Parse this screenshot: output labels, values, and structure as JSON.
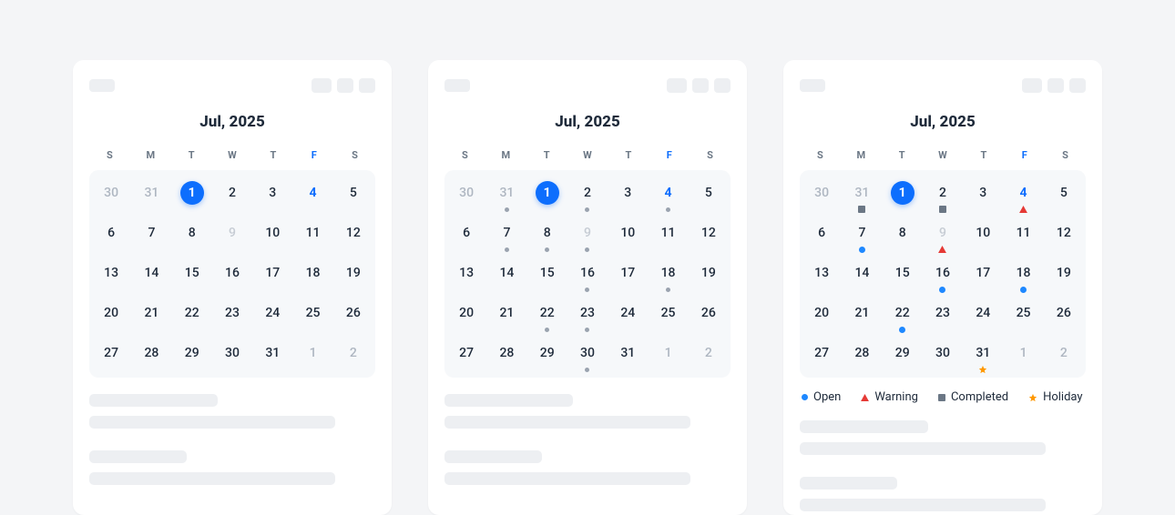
{
  "month_label": "Jul, 2025",
  "dow": [
    "S",
    "M",
    "T",
    "W",
    "T",
    "F",
    "S"
  ],
  "legend": {
    "open": "Open",
    "warning": "Warning",
    "completed": "Completed",
    "holiday": "Holiday"
  },
  "calendars": [
    {
      "id": "plain",
      "weeks": [
        [
          {
            "n": 30,
            "out": true
          },
          {
            "n": 31,
            "out": true
          },
          {
            "n": 1,
            "sel": true
          },
          {
            "n": 2
          },
          {
            "n": 3
          },
          {
            "n": 4,
            "fri": true
          },
          {
            "n": 5
          }
        ],
        [
          {
            "n": 6
          },
          {
            "n": 7
          },
          {
            "n": 8
          },
          {
            "n": 9,
            "dis": true
          },
          {
            "n": 10
          },
          {
            "n": 11
          },
          {
            "n": 12
          }
        ],
        [
          {
            "n": 13
          },
          {
            "n": 14
          },
          {
            "n": 15
          },
          {
            "n": 16
          },
          {
            "n": 17
          },
          {
            "n": 18
          },
          {
            "n": 19
          }
        ],
        [
          {
            "n": 20
          },
          {
            "n": 21
          },
          {
            "n": 22
          },
          {
            "n": 23
          },
          {
            "n": 24
          },
          {
            "n": 25
          },
          {
            "n": 26
          }
        ],
        [
          {
            "n": 27
          },
          {
            "n": 28
          },
          {
            "n": 29
          },
          {
            "n": 30
          },
          {
            "n": 31
          },
          {
            "n": 1,
            "out": true
          },
          {
            "n": 2,
            "out": true
          }
        ]
      ]
    },
    {
      "id": "dots",
      "weeks": [
        [
          {
            "n": 30,
            "out": true
          },
          {
            "n": 31,
            "out": true,
            "marks": [
              "dot"
            ]
          },
          {
            "n": 1,
            "sel": true
          },
          {
            "n": 2,
            "marks": [
              "dot"
            ]
          },
          {
            "n": 3
          },
          {
            "n": 4,
            "fri": true,
            "marks": [
              "dot"
            ]
          },
          {
            "n": 5
          }
        ],
        [
          {
            "n": 6
          },
          {
            "n": 7,
            "marks": [
              "dot"
            ]
          },
          {
            "n": 8,
            "marks": [
              "dot"
            ]
          },
          {
            "n": 9,
            "dis": true,
            "marks": [
              "dot"
            ]
          },
          {
            "n": 10
          },
          {
            "n": 11
          },
          {
            "n": 12
          }
        ],
        [
          {
            "n": 13
          },
          {
            "n": 14
          },
          {
            "n": 15
          },
          {
            "n": 16,
            "marks": [
              "dot"
            ]
          },
          {
            "n": 17
          },
          {
            "n": 18,
            "marks": [
              "dot"
            ]
          },
          {
            "n": 19
          }
        ],
        [
          {
            "n": 20
          },
          {
            "n": 21
          },
          {
            "n": 22,
            "marks": [
              "dot"
            ]
          },
          {
            "n": 23,
            "marks": [
              "dot"
            ]
          },
          {
            "n": 24
          },
          {
            "n": 25
          },
          {
            "n": 26
          }
        ],
        [
          {
            "n": 27
          },
          {
            "n": 28
          },
          {
            "n": 29
          },
          {
            "n": 30,
            "marks": [
              "dot"
            ]
          },
          {
            "n": 31
          },
          {
            "n": 1,
            "out": true
          },
          {
            "n": 2,
            "out": true
          }
        ]
      ]
    },
    {
      "id": "colored",
      "has_legend": true,
      "weeks": [
        [
          {
            "n": 30,
            "out": true
          },
          {
            "n": 31,
            "out": true,
            "marks": [
              "comp"
            ]
          },
          {
            "n": 1,
            "sel": true
          },
          {
            "n": 2,
            "marks": [
              "comp"
            ]
          },
          {
            "n": 3
          },
          {
            "n": 4,
            "fri": true,
            "marks": [
              "warn"
            ]
          },
          {
            "n": 5
          }
        ],
        [
          {
            "n": 6
          },
          {
            "n": 7,
            "marks": [
              "open"
            ]
          },
          {
            "n": 8
          },
          {
            "n": 9,
            "dis": true,
            "marks": [
              "warn"
            ]
          },
          {
            "n": 10
          },
          {
            "n": 11
          },
          {
            "n": 12
          }
        ],
        [
          {
            "n": 13
          },
          {
            "n": 14
          },
          {
            "n": 15
          },
          {
            "n": 16,
            "marks": [
              "open"
            ]
          },
          {
            "n": 17
          },
          {
            "n": 18,
            "marks": [
              "open"
            ]
          },
          {
            "n": 19
          }
        ],
        [
          {
            "n": 20
          },
          {
            "n": 21
          },
          {
            "n": 22,
            "marks": [
              "open"
            ]
          },
          {
            "n": 23
          },
          {
            "n": 24
          },
          {
            "n": 25
          },
          {
            "n": 26
          }
        ],
        [
          {
            "n": 27
          },
          {
            "n": 28
          },
          {
            "n": 29
          },
          {
            "n": 30
          },
          {
            "n": 31,
            "marks": [
              "hol"
            ]
          },
          {
            "n": 1,
            "out": true
          },
          {
            "n": 2,
            "out": true
          }
        ]
      ]
    }
  ]
}
